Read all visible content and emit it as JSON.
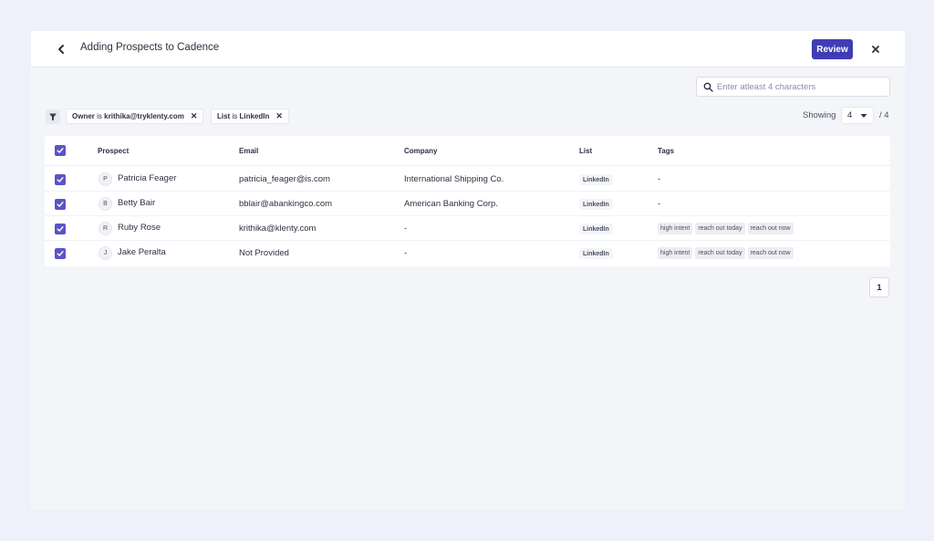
{
  "header": {
    "title": "Adding Prospects to Cadence",
    "review_label": "Review"
  },
  "search": {
    "placeholder": "Enter atleast 4 characters"
  },
  "filters": [
    {
      "key": "Owner",
      "op": "is",
      "value": "krithika@tryklenty.com"
    },
    {
      "key": "List",
      "op": "is",
      "value": "LinkedIn"
    }
  ],
  "pagination": {
    "showing_label": "Showing",
    "per_page": "4",
    "total": "/ 4",
    "current_page": "1"
  },
  "table": {
    "columns": [
      "Prospect",
      "Email",
      "Company",
      "List",
      "Tags"
    ],
    "rows": [
      {
        "initial": "P",
        "name": "Patricia Feager",
        "email": "patricia_feager@is.com",
        "company": "International Shipping Co.",
        "list": "LinkedIn",
        "tags": [],
        "tags_empty": "-"
      },
      {
        "initial": "B",
        "name": "Betty Bair",
        "email": "bblair@abankingco.com",
        "company": "American Banking Corp.",
        "list": "LinkedIn",
        "tags": [],
        "tags_empty": "-"
      },
      {
        "initial": "R",
        "name": "Ruby Rose",
        "email": "krithika@klenty.com",
        "company": "-",
        "list": "LinkedIn",
        "tags": [
          "high intent",
          "reach out today",
          "reach out now"
        ]
      },
      {
        "initial": "J",
        "name": "Jake Peralta",
        "email": "Not Provided",
        "company": "-",
        "list": "LinkedIn",
        "tags": [
          "high intent",
          "reach out today",
          "reach out now"
        ]
      }
    ]
  },
  "colors": {
    "accent": "#3f3db3",
    "checkbox": "#5b54c7",
    "page_bg": "#eef0fb"
  }
}
